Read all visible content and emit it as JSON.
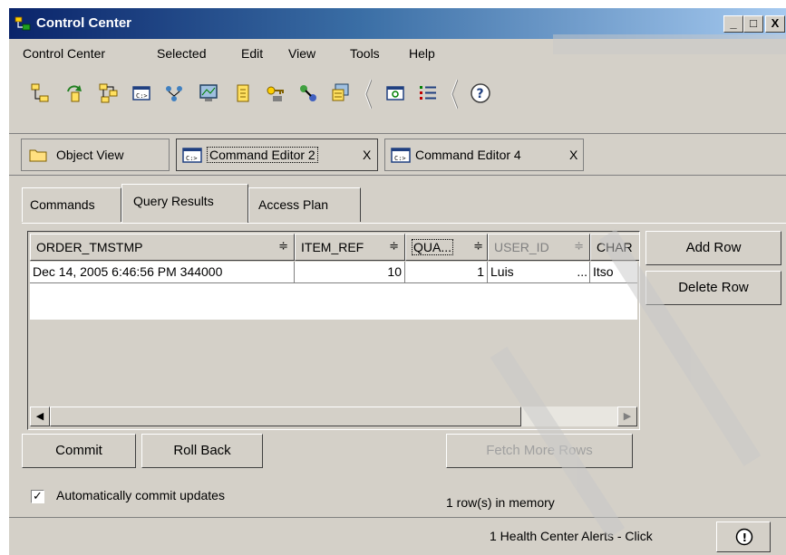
{
  "window": {
    "title": "Control Center",
    "controls": {
      "minimize": "_",
      "maximize": "□",
      "close": "X"
    }
  },
  "menu": [
    "Control Center",
    "Selected",
    "Edit",
    "View",
    "Tools",
    "Help"
  ],
  "toolbar": {
    "icons": [
      "tree-icon",
      "refresh-objects-icon",
      "network-icon",
      "command-editor-icon",
      "plan-icon",
      "monitor-icon",
      "journal-icon",
      "license-icon",
      "tools-settings-icon",
      "task-center-icon",
      "replication-icon",
      "list-icon",
      "help-icon"
    ]
  },
  "editor_tabs": [
    {
      "label": "Object View",
      "close": ""
    },
    {
      "label": "Command Editor 2",
      "close": "X"
    },
    {
      "label": "Command Editor 4",
      "close": "X"
    }
  ],
  "result_tabs": [
    "Commands",
    "Query Results",
    "Access Plan"
  ],
  "table": {
    "columns": [
      "ORDER_TMSTMP",
      "ITEM_REF",
      "QUA...",
      "USER_ID",
      "CHAR"
    ],
    "sort_glyph": "≑",
    "rows": [
      [
        "Dec 14, 2005 6:46:56 PM 344000",
        "10",
        "1",
        "Luis",
        "...",
        "Itso"
      ]
    ]
  },
  "side_buttons": {
    "add_row": "Add Row",
    "delete_row": "Delete Row"
  },
  "bottom_buttons": {
    "commit": "Commit",
    "rollback": "Roll Back",
    "fetch_more": "Fetch More Rows"
  },
  "auto_commit": {
    "label": "Automatically commit updates",
    "checked": true
  },
  "rows_in_memory": "1 row(s) in memory",
  "status": {
    "health_alerts": "1 Health Center Alerts - Click",
    "alert_glyph": "!"
  }
}
